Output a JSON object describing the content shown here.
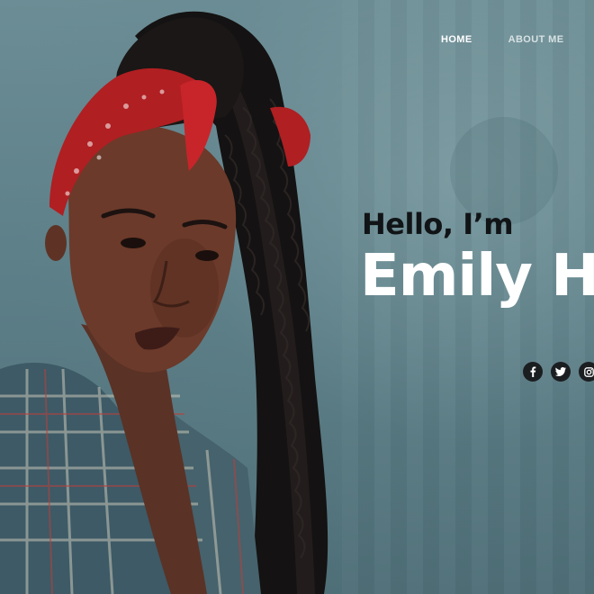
{
  "nav": {
    "items": [
      {
        "label": "HOME",
        "active": true
      },
      {
        "label": "ABOUT ME",
        "active": false
      }
    ]
  },
  "hero": {
    "greeting": "Hello, I’m",
    "name": "Emily H",
    "portrait_icon": "portrait-photo"
  },
  "social": {
    "icons": [
      "facebook-icon",
      "twitter-icon",
      "instagram-icon"
    ]
  },
  "colors": {
    "background": "#5b7c84",
    "greeting_text": "#111416",
    "name_text": "#ffffff",
    "social_button": "#1b1e20"
  }
}
